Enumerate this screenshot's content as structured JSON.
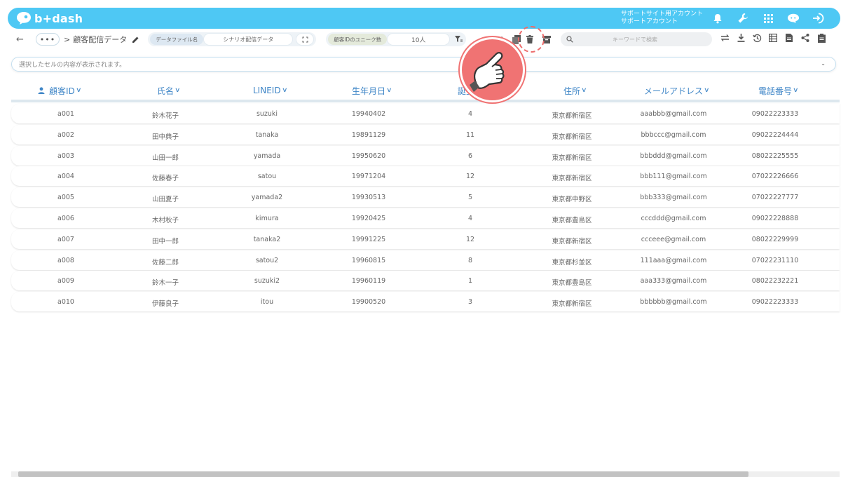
{
  "app": {
    "logo_text": "b+dash"
  },
  "header": {
    "account_line1": "サポートサイト用アカウント",
    "account_line2": "サポートアカウント"
  },
  "toolbar": {
    "more_label": "•••",
    "breadcrumb_separator": ">",
    "breadcrumb_title": "顧客配信データ",
    "datafile_tag": "データファイル名",
    "datafile_value": "シナリオ配信データ",
    "unique_tag": "顧客IDのユニーク数",
    "unique_value": "10人",
    "search_placeholder": "キーワードで検索"
  },
  "cell_display": {
    "placeholder": "選択したセルの内容が表示されます。"
  },
  "table": {
    "columns": [
      "顧客ID",
      "氏名",
      "LINEID",
      "生年月日",
      "誕生月",
      "住所",
      "メールアドレス",
      "電話番号"
    ],
    "rows": [
      [
        "a001",
        "鈴木花子",
        "suzuki",
        "19940402",
        "4",
        "東京都新宿区",
        "aaabbb@gmail.com",
        "09022223333"
      ],
      [
        "a002",
        "田中典子",
        "tanaka",
        "19891129",
        "11",
        "東京都新宿区",
        "bbbccc@gmail.com",
        "09022224444"
      ],
      [
        "a003",
        "山田一郎",
        "yamada",
        "19950620",
        "6",
        "東京都新宿区",
        "bbbddd@gmail.com",
        "08022225555"
      ],
      [
        "a004",
        "佐藤春子",
        "satou",
        "19971204",
        "12",
        "東京都新宿区",
        "bbb111@gmail.com",
        "07022226666"
      ],
      [
        "a005",
        "山田夏子",
        "yamada2",
        "19930513",
        "5",
        "東京都中野区",
        "bbb333@gmail.com",
        "07022227777"
      ],
      [
        "a006",
        "木村秋子",
        "kimura",
        "19920425",
        "4",
        "東京都豊島区",
        "cccddd@gmail.com",
        "09022228888"
      ],
      [
        "a007",
        "田中一郎",
        "tanaka2",
        "19991225",
        "12",
        "東京都新宿区",
        "ccceee@gmail.com",
        "08022229999"
      ],
      [
        "a008",
        "佐藤二郎",
        "satou2",
        "19960815",
        "8",
        "東京都杉並区",
        "111aaa@gmail.com",
        "07022231110"
      ],
      [
        "a009",
        "鈴木一子",
        "suzuki2",
        "19960119",
        "1",
        "東京都豊島区",
        "aaa333@gmail.com",
        "08022232221"
      ],
      [
        "a010",
        "伊藤良子",
        "itou",
        "19900520",
        "3",
        "東京都新宿区",
        "bbbbbb@gmail.com",
        "09022223333"
      ]
    ]
  },
  "colors": {
    "brand": "#4ec8f4",
    "header_text": "#3f86c7",
    "cursor": "#f07373"
  }
}
